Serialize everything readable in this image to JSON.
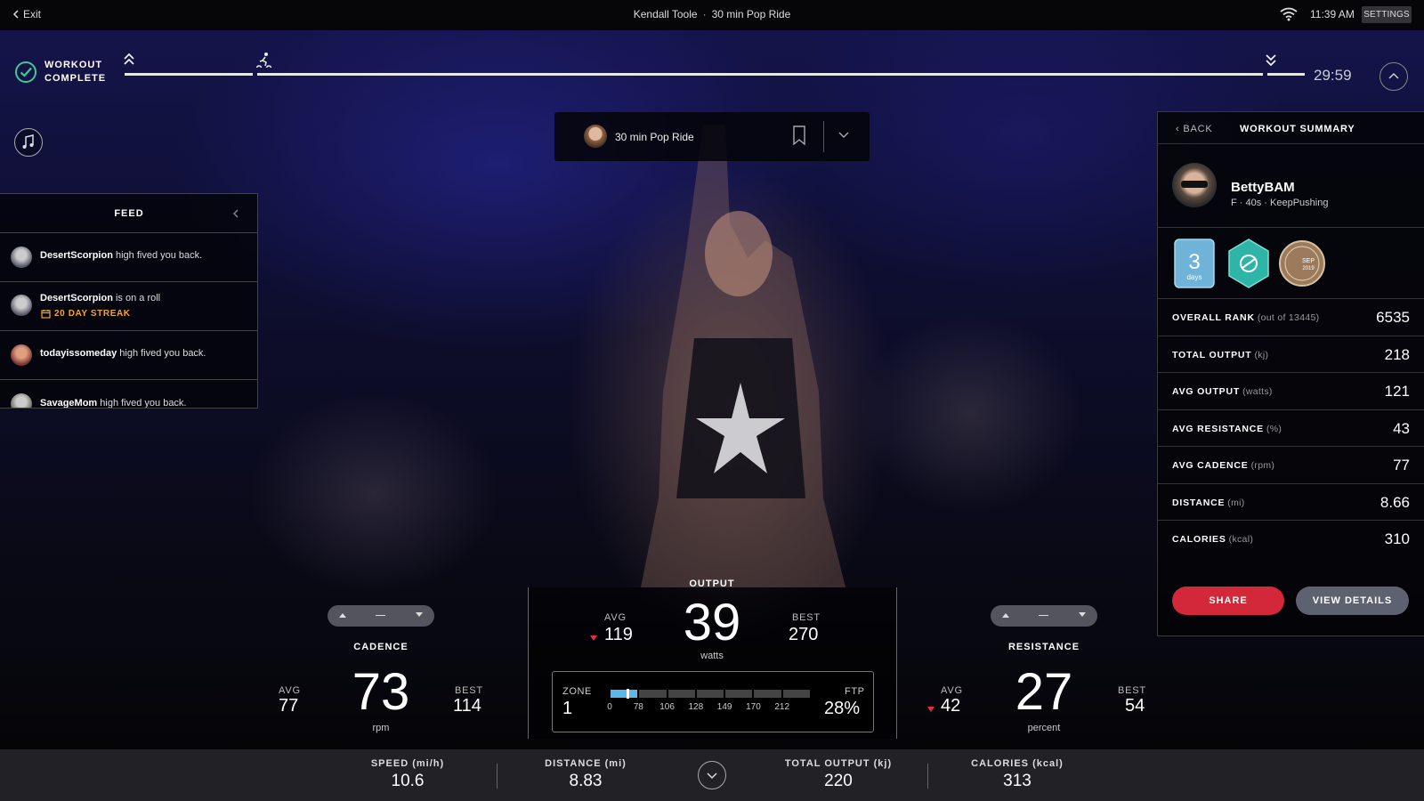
{
  "topbar": {
    "exit_label": "Exit",
    "instructor": "Kendall Toole",
    "class_name": "30 min Pop Ride",
    "time": "11:39 AM",
    "settings_label": "SETTINGS"
  },
  "progress": {
    "complete_line1": "WORKOUT",
    "complete_line2": "COMPLETE",
    "timer": "29:59"
  },
  "class_card": {
    "title": "30 min Pop Ride"
  },
  "feed": {
    "title": "FEED",
    "items": [
      {
        "user": "DesertScorpion",
        "action": "high fived you back."
      },
      {
        "user": "DesertScorpion",
        "action": "is on a roll",
        "streak": "20 DAY STREAK"
      },
      {
        "user": "todayissomeday",
        "action": "high fived you back."
      },
      {
        "user": "SavageMom",
        "action": "high fived you back."
      }
    ]
  },
  "summary": {
    "back_label": "BACK",
    "title": "WORKOUT SUMMARY",
    "username": "BettyBAM",
    "user_sub": "F · 40s · KeepPushing",
    "badges": {
      "streak_num": "3",
      "streak_unit": "days",
      "date_badge_month": "SEP",
      "date_badge_year": "2019"
    },
    "stats": [
      {
        "label": "OVERALL RANK",
        "unit": "(out of 13445)",
        "value": "6535"
      },
      {
        "label": "TOTAL OUTPUT",
        "unit": "(kj)",
        "value": "218"
      },
      {
        "label": "AVG OUTPUT",
        "unit": "(watts)",
        "value": "121"
      },
      {
        "label": "AVG RESISTANCE",
        "unit": "(%)",
        "value": "43"
      },
      {
        "label": "AVG CADENCE",
        "unit": "(rpm)",
        "value": "77"
      },
      {
        "label": "DISTANCE",
        "unit": "(mi)",
        "value": "8.66"
      },
      {
        "label": "CALORIES",
        "unit": "(kcal)",
        "value": "310"
      }
    ],
    "share_label": "SHARE",
    "details_label": "VIEW DETAILS"
  },
  "cadence": {
    "label": "CADENCE",
    "value": "73",
    "unit": "rpm",
    "avg_label": "AVG",
    "avg": "77",
    "best_label": "BEST",
    "best": "114"
  },
  "output": {
    "label": "OUTPUT",
    "value": "39",
    "unit": "watts",
    "avg_label": "AVG",
    "avg": "119",
    "best_label": "BEST",
    "best": "270"
  },
  "zone": {
    "label": "ZONE",
    "value": "1",
    "ticks": [
      "0",
      "78",
      "106",
      "128",
      "149",
      "170",
      "212"
    ],
    "ftp_label": "FTP",
    "ftp_value": "28%",
    "fill_fraction": 0.28
  },
  "resistance": {
    "label": "RESISTANCE",
    "value": "27",
    "unit": "percent",
    "avg_label": "AVG",
    "avg": "42",
    "best_label": "BEST",
    "best": "54"
  },
  "bottom": {
    "speed_label": "SPEED (mi/h)",
    "speed": "10.6",
    "distance_label": "DISTANCE (mi)",
    "distance": "8.83",
    "output_label": "TOTAL OUTPUT (kj)",
    "output": "220",
    "calories_label": "CALORIES (kcal)",
    "calories": "313"
  },
  "colors": {
    "accent_green": "#3fc99a",
    "share_red": "#d3283a",
    "streak_orange": "#f5a623",
    "zone_blue": "#5bb8ea"
  }
}
